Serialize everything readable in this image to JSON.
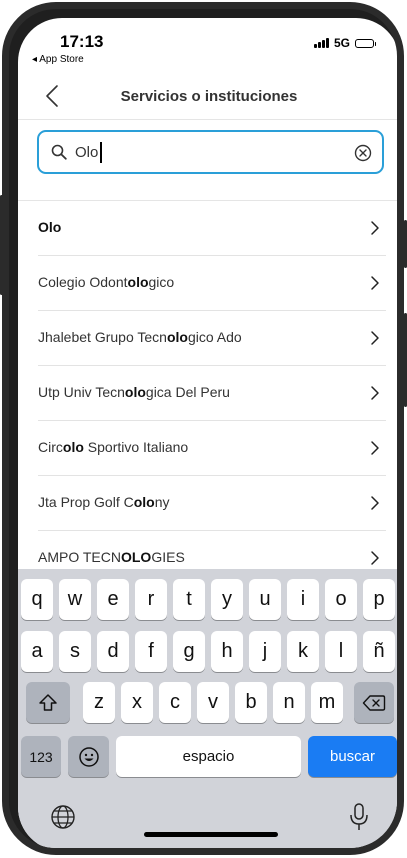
{
  "status_bar": {
    "time": "17:13",
    "back_app": "◂ App Store",
    "network": "5G"
  },
  "nav": {
    "title": "Servicios o instituciones",
    "back_icon": "chevron-left-icon"
  },
  "search": {
    "value": "Olo",
    "placeholder": "",
    "search_icon": "magnifier-icon",
    "clear_icon": "clear-circle-icon",
    "accent": "#2a9fd8"
  },
  "results": [
    {
      "parts": [
        {
          "text": "Olo",
          "bold": true
        }
      ]
    },
    {
      "parts": [
        {
          "text": "Colegio Odont",
          "bold": false
        },
        {
          "text": "olo",
          "bold": true
        },
        {
          "text": "gico",
          "bold": false
        }
      ]
    },
    {
      "parts": [
        {
          "text": "Jhalebet Grupo Tecn",
          "bold": false
        },
        {
          "text": "olo",
          "bold": true
        },
        {
          "text": "gico Ado",
          "bold": false
        }
      ]
    },
    {
      "parts": [
        {
          "text": "Utp Univ Tecn",
          "bold": false
        },
        {
          "text": "olo",
          "bold": true
        },
        {
          "text": "gica Del Peru",
          "bold": false
        }
      ]
    },
    {
      "parts": [
        {
          "text": "Circ",
          "bold": false
        },
        {
          "text": "olo",
          "bold": true
        },
        {
          "text": " Sportivo Italiano",
          "bold": false
        }
      ]
    },
    {
      "parts": [
        {
          "text": "Jta Prop Golf C",
          "bold": false
        },
        {
          "text": "olo",
          "bold": true
        },
        {
          "text": "ny",
          "bold": false
        }
      ]
    },
    {
      "parts": [
        {
          "text": "AMPO TECN",
          "bold": false
        },
        {
          "text": "OLO",
          "bold": true
        },
        {
          "text": "GIES",
          "bold": false
        }
      ]
    }
  ],
  "keyboard": {
    "row1": [
      "q",
      "w",
      "e",
      "r",
      "t",
      "y",
      "u",
      "i",
      "o",
      "p"
    ],
    "row2": [
      "a",
      "s",
      "d",
      "f",
      "g",
      "h",
      "j",
      "k",
      "l",
      "ñ"
    ],
    "row3": [
      "z",
      "x",
      "c",
      "v",
      "b",
      "n",
      "m"
    ],
    "numbers_label": "123",
    "space_label": "espacio",
    "go_label": "buscar",
    "go_color": "#1a7cf3",
    "icons": {
      "shift": "shift-icon",
      "delete": "delete-icon",
      "emoji": "emoji-icon",
      "globe": "globe-icon",
      "mic": "microphone-icon"
    }
  }
}
